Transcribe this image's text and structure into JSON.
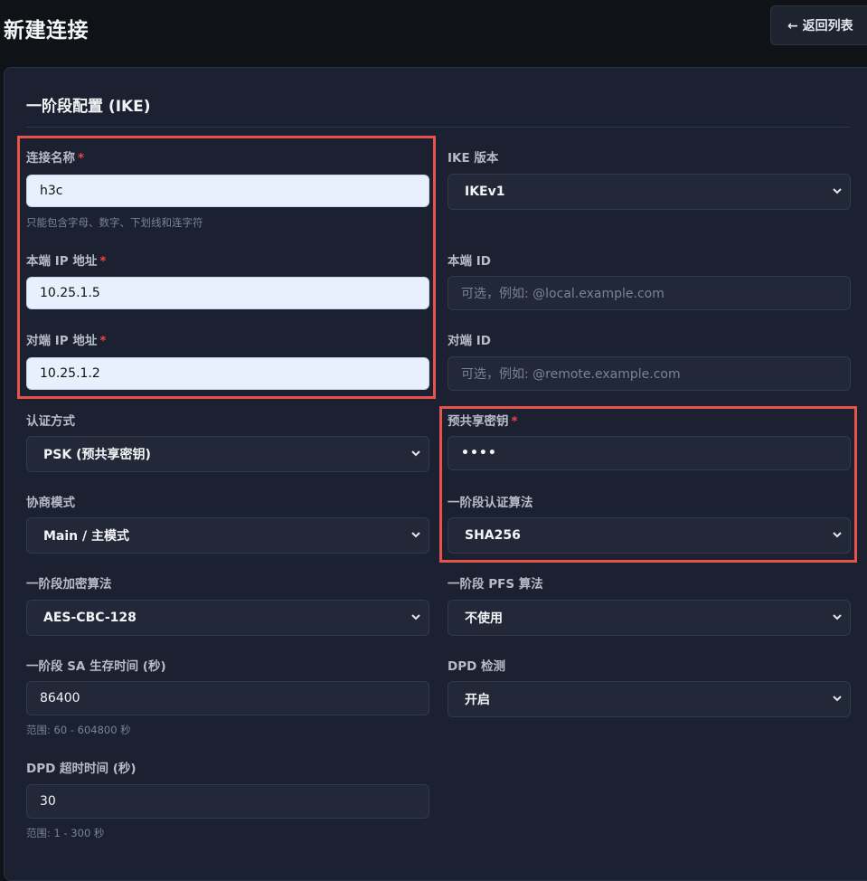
{
  "header": {
    "title": "新建连接",
    "back_label": "← 返回列表"
  },
  "section": {
    "title": "一阶段配置 (IKE)"
  },
  "fields": {
    "conn_name": {
      "label": "连接名称",
      "value": "h3c",
      "hint": "只能包含字母、数字、下划线和连字符"
    },
    "ike_version": {
      "label": "IKE 版本",
      "value": "IKEv1"
    },
    "local_ip": {
      "label": "本端 IP 地址",
      "value": "10.25.1.5"
    },
    "local_id": {
      "label": "本端 ID",
      "placeholder": "可选，例如: @local.example.com"
    },
    "remote_ip": {
      "label": "对端 IP 地址",
      "value": "10.25.1.2"
    },
    "remote_id": {
      "label": "对端 ID",
      "placeholder": "可选，例如: @remote.example.com"
    },
    "auth_method": {
      "label": "认证方式",
      "value": "PSK (预共享密钥)"
    },
    "psk": {
      "label": "预共享密钥",
      "value": "••••"
    },
    "nego_mode": {
      "label": "协商模式",
      "value": "Main / 主模式"
    },
    "p1_auth_alg": {
      "label": "一阶段认证算法",
      "value": "SHA256"
    },
    "p1_enc_alg": {
      "label": "一阶段加密算法",
      "value": "AES-CBC-128"
    },
    "p1_pfs": {
      "label": "一阶段 PFS 算法",
      "value": "不使用"
    },
    "sa_lifetime": {
      "label": "一阶段 SA 生存时间 (秒)",
      "value": "86400",
      "hint": "范围: 60 - 604800 秒"
    },
    "dpd": {
      "label": "DPD 检测",
      "value": "开启"
    },
    "dpd_timeout": {
      "label": "DPD 超时时间 (秒)",
      "value": "30",
      "hint": "范围: 1 - 300 秒"
    }
  },
  "required_mark": "*",
  "colors": {
    "background": "#0f1318",
    "card": "#1b2130",
    "input": "#222838",
    "autofill": "#e8f0fe",
    "required": "#ef4444",
    "highlight": "#e5534b"
  },
  "icons": {
    "select_arrow": "chevron-down-icon"
  }
}
